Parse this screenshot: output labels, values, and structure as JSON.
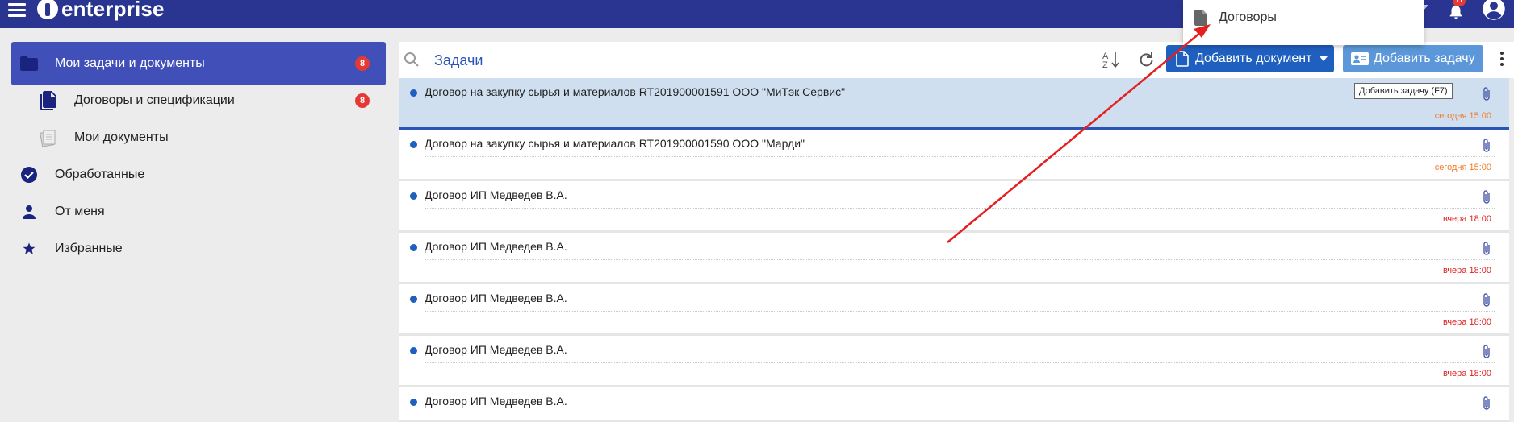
{
  "app": {
    "logo_text": "enterprise",
    "notifications_count": "11"
  },
  "sidebar": {
    "items": [
      {
        "label": "Мои задачи и документы",
        "badge": "8",
        "icon": "folder-icon"
      },
      {
        "label": "Договоры и спецификации",
        "badge": "8",
        "icon": "document-stack-icon"
      },
      {
        "label": "Мои документы",
        "badge": "",
        "icon": "papers-icon"
      },
      {
        "label": "Обработанные",
        "badge": "",
        "icon": "check-circle-icon"
      },
      {
        "label": "От меня",
        "badge": "",
        "icon": "person-icon"
      },
      {
        "label": "Избранные",
        "badge": "",
        "icon": "star-icon"
      }
    ]
  },
  "toolbar": {
    "search_value": "Задачи",
    "add_document_label": "Добавить документ",
    "add_task_label": "Добавить задачу",
    "colors": {
      "primary": "#1f5fbf",
      "secondary": "#5c98d9",
      "header": "#2a3591"
    }
  },
  "dropdown": {
    "items": [
      {
        "label": "Договоры",
        "icon": "file-icon"
      }
    ]
  },
  "tooltip": {
    "text": "Добавить задачу (F7)"
  },
  "tasks": [
    {
      "title": "Договор на закупку сырья и материалов RT201900001591 ООО \"МиТэк Сервис\"",
      "time": "сегодня 15:00",
      "kind": "today",
      "selected": true
    },
    {
      "title": "Договор на закупку сырья и материалов RT201900001590 ООО \"Марди\"",
      "time": "сегодня 15:00",
      "kind": "today",
      "selected": false
    },
    {
      "title": "Договор ИП Медведев В.А.",
      "time": "вчера 18:00",
      "kind": "yesterday",
      "selected": false
    },
    {
      "title": "Договор ИП Медведев В.А.",
      "time": "вчера 18:00",
      "kind": "yesterday",
      "selected": false
    },
    {
      "title": "Договор ИП Медведев В.А.",
      "time": "вчера 18:00",
      "kind": "yesterday",
      "selected": false
    },
    {
      "title": "Договор ИП Медведев В.А.",
      "time": "вчера 18:00",
      "kind": "yesterday",
      "selected": false
    },
    {
      "title": "Договор ИП Медведев В.А.",
      "time": "",
      "kind": "yesterday",
      "selected": false
    }
  ]
}
